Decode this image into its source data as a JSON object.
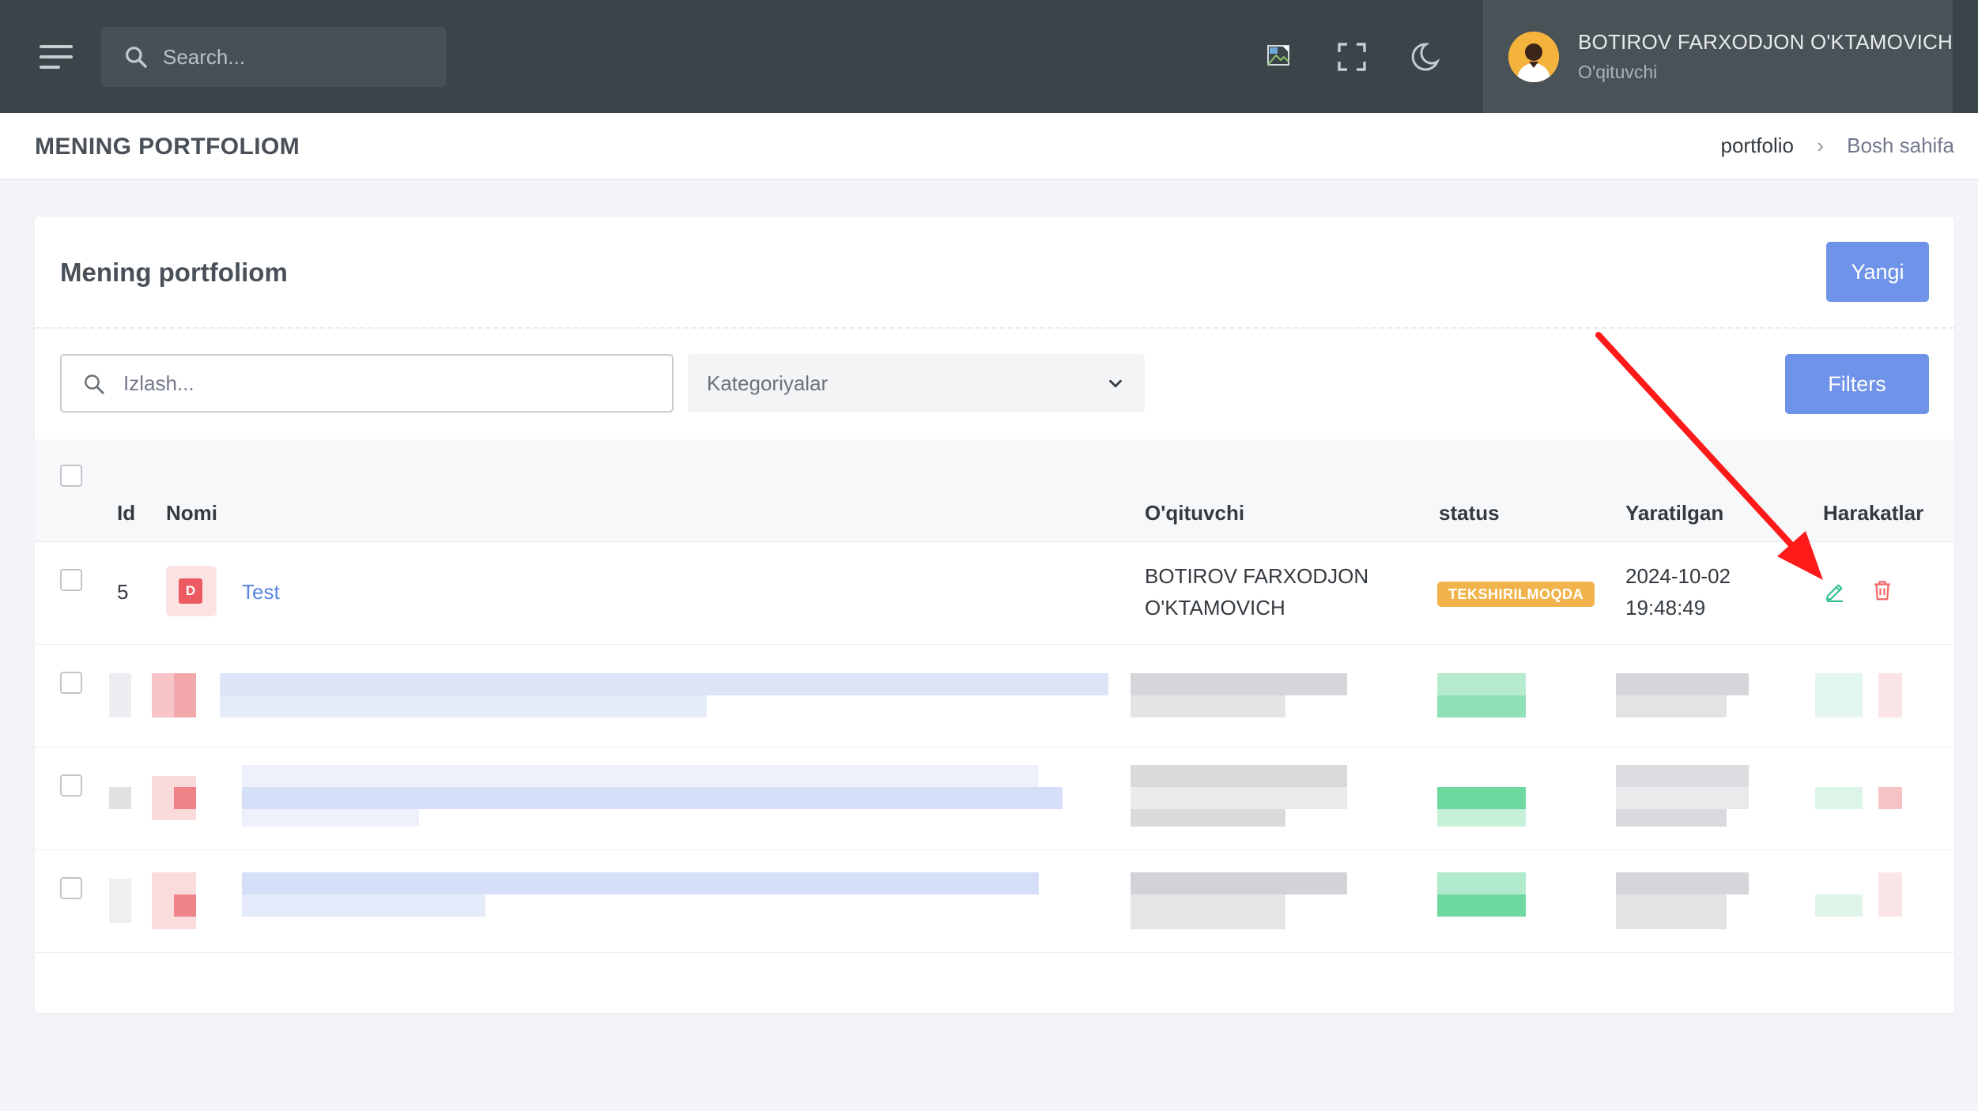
{
  "header": {
    "search_placeholder": "Search...",
    "user": {
      "name": "BOTIROV FARXODJON O'KTAMOVICH",
      "role": "O'qituvchi"
    }
  },
  "page": {
    "title": "MENING PORTFOLIOM",
    "breadcrumb": [
      "portfolio",
      "Bosh sahifa"
    ]
  },
  "card": {
    "title": "Mening portfoliom",
    "new_button": "Yangi",
    "filter_search_placeholder": "Izlash...",
    "category_select": "Kategoriyalar",
    "filters_button": "Filters"
  },
  "table": {
    "columns": [
      "Id",
      "Nomi",
      "O'qituvchi",
      "status",
      "Yaratilgan",
      "Harakatlar"
    ],
    "rows": [
      {
        "id": "5",
        "file_icon_letter": "D",
        "name": "Test",
        "teacher_line1": "BOTIROV FARXODJON",
        "teacher_line2": "O'KTAMOVICH",
        "status": "TEKSHIRILMOQDA",
        "created_date": "2024-10-02",
        "created_time": "19:48:49"
      }
    ]
  },
  "colors": {
    "topbar": "#3a4449",
    "primary": "#6f93e8",
    "status_warning": "#f1b44c",
    "edit_icon": "#34c38f",
    "delete_icon": "#f46a6a",
    "annotation_arrow": "#ff1a1a"
  }
}
